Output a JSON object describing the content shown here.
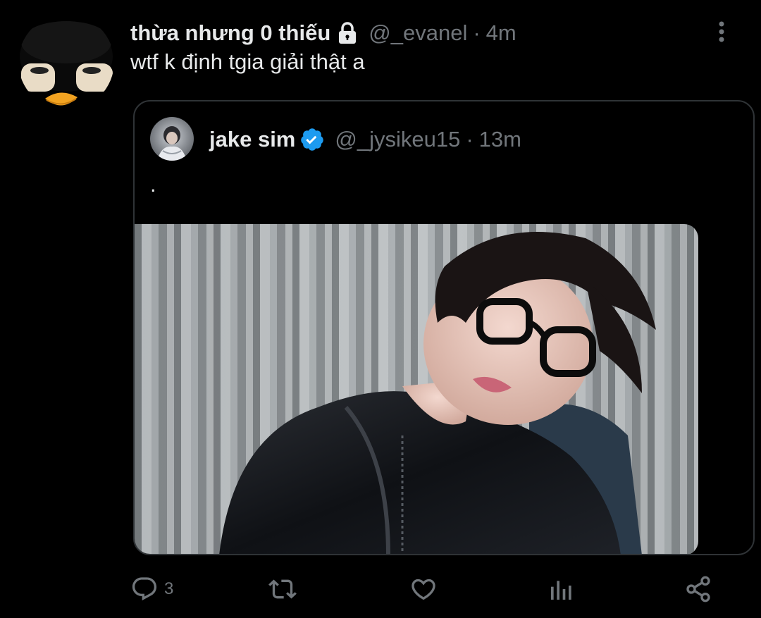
{
  "tweet": {
    "display_name": "thừa nhưng 0 thiếu",
    "handle": "@_evanel",
    "separator": "·",
    "time": "4m",
    "text": "wtf k định tgia giải thật a",
    "avatar_icon": "penguin-avatar-icon",
    "protected_icon": "lock-icon"
  },
  "quote": {
    "display_name": "jake sim",
    "handle": "@_jysikeu15",
    "separator": "·",
    "time": "13m",
    "text": ".",
    "verified_icon": "verified-badge-icon",
    "media_description_icon": "photo"
  },
  "actions": {
    "reply_count": "3",
    "retweet_count": "",
    "like_count": "",
    "views_count": ""
  },
  "colors": {
    "background": "#000000",
    "text_primary": "#e7e9ea",
    "text_secondary": "#71767b",
    "border": "#2f3336",
    "verified_blue": "#1d9bf0"
  }
}
